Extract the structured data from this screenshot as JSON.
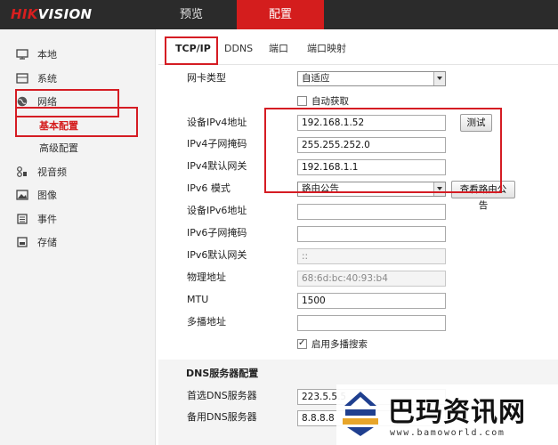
{
  "app": {
    "logo_part1": "HIK",
    "logo_part2": "VISION"
  },
  "topnav": {
    "preview": "预览",
    "config": "配置"
  },
  "sidebar": {
    "items": [
      {
        "label": "本地",
        "icon": "monitor-icon"
      },
      {
        "label": "系统",
        "icon": "system-icon"
      },
      {
        "label": "网络",
        "icon": "globe-icon"
      },
      {
        "label": "视音频",
        "icon": "audio-video-icon"
      },
      {
        "label": "图像",
        "icon": "image-icon"
      },
      {
        "label": "事件",
        "icon": "event-icon"
      },
      {
        "label": "存储",
        "icon": "storage-icon"
      }
    ],
    "network_sub": {
      "basic": "基本配置",
      "advanced": "高级配置"
    }
  },
  "subtabs": [
    "TCP/IP",
    "DDNS",
    "端口",
    "端口映射"
  ],
  "form": {
    "nic_type_label": "网卡类型",
    "nic_type_value": "自适应",
    "dhcp_label": "自动获取",
    "ipv4_addr_label": "设备IPv4地址",
    "ipv4_addr_value": "192.168.1.52",
    "test_button": "测试",
    "ipv4_mask_label": "IPv4子网掩码",
    "ipv4_mask_value": "255.255.252.0",
    "ipv4_gw_label": "IPv4默认网关",
    "ipv4_gw_value": "192.168.1.1",
    "ipv6_mode_label": "IPv6 模式",
    "ipv6_mode_value": "路由公告",
    "ipv6_view_button": "查看路由公告",
    "ipv6_addr_label": "设备IPv6地址",
    "ipv6_addr_value": "",
    "ipv6_mask_label": "IPv6子网掩码",
    "ipv6_mask_value": "",
    "ipv6_gw_label": "IPv6默认网关",
    "ipv6_gw_value": "::",
    "mac_label": "物理地址",
    "mac_value": "68:6d:bc:40:93:b4",
    "mtu_label": "MTU",
    "mtu_value": "1500",
    "multicast_label": "多播地址",
    "multicast_value": "",
    "multicast_search_label": "启用多播搜索"
  },
  "dns": {
    "section_title": "DNS服务器配置",
    "preferred_label": "首选DNS服务器",
    "preferred_value": "223.5.5.5",
    "alternate_label": "备用DNS服务器",
    "alternate_value": "8.8.8.8"
  },
  "watermark": {
    "title": "巴玛资讯网",
    "url": "www.bamoworld.com"
  },
  "colors": {
    "accent": "#d41d1d",
    "topbar": "#2b2b2b",
    "highlight": "#d51c23"
  }
}
